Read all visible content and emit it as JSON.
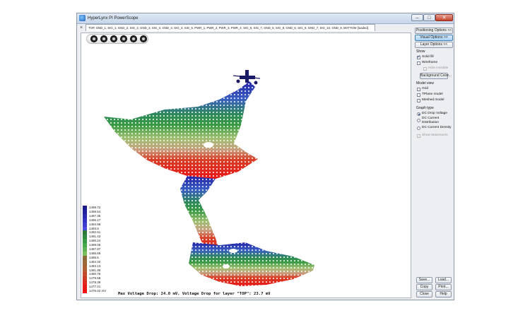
{
  "window": {
    "title": "HyperLynx PI PowerScope",
    "min_symbol": "–",
    "max_symbol": "□",
    "close_symbol": "✕"
  },
  "tab": {
    "close_symbol": "×",
    "label": "TOP, GND_1, SIG_1, GND_2, SIG_2, GND_3, SIG_3, GND_4, SIG_4, SIG_5, PWR_1, PWR_2, PWR_3, PWR_4, SIG_6, SIG_7, GND_5, SIG_8, GND_6, SIG_9, GND_7, SIG_10, GND_8, BOTTOM [loaded]"
  },
  "viewport": {
    "toolbar_icons": [
      "rotate-icon",
      "pan-icon",
      "zoom-icon",
      "zoom-fit-icon",
      "view-front-icon",
      "view-top-icon"
    ],
    "status": "Max Voltage Drop: 24.0 mV, Voltage Drop for layer \"TOP\": 23.7 mV"
  },
  "legend": {
    "entries": [
      {
        "value": "1499.72",
        "color": "#1a1a8c"
      },
      {
        "value": "1498.54",
        "color": "#22229e"
      },
      {
        "value": "1497.35",
        "color": "#2a2ab0"
      },
      {
        "value": "1496.17",
        "color": "#3232c2"
      },
      {
        "value": "1494.98",
        "color": "#3d3dd1"
      },
      {
        "value": "1493.8",
        "color": "#4a4ade"
      },
      {
        "value": "1492.61",
        "color": "#2e7a3c"
      },
      {
        "value": "1491.43",
        "color": "#2f8a3f"
      },
      {
        "value": "1490.24",
        "color": "#379a44"
      },
      {
        "value": "1489.06",
        "color": "#45a84c"
      },
      {
        "value": "1487.87",
        "color": "#5db356"
      },
      {
        "value": "1486.69",
        "color": "#7fbd5c"
      },
      {
        "value": "1485.5",
        "color": "#8a6a3a"
      },
      {
        "value": "1484.32",
        "color": "#9a6a38"
      },
      {
        "value": "1483.13",
        "color": "#a56235"
      },
      {
        "value": "1481.95",
        "color": "#b55a30"
      },
      {
        "value": "1480.76",
        "color": "#c24a2a"
      },
      {
        "value": "1479.58",
        "color": "#cf3a24"
      },
      {
        "value": "1478.39",
        "color": "#dc2a1e"
      },
      {
        "value": "1477.21",
        "color": "#e81a18"
      },
      {
        "value": "1476.02 mV",
        "color": "#f21010"
      }
    ]
  },
  "panel": {
    "positioning_options": "Positioning Options <<",
    "visual_options": "Visual Options >>",
    "layer_options": "Layer Options <<",
    "show_label": "Show",
    "solid_fill": "Solid fill",
    "wireframe": "Wireframe",
    "hide_invisible": "Hide invisible",
    "background_color": "Background Color...",
    "model_view_label": "Model view",
    "grid": "Grid",
    "tplane_model": "TPlane model",
    "meshed_model": "Meshed model",
    "graph_type_label": "Graph type",
    "dc_drop_voltage": "DC Drop Voltage",
    "dc_current_distribution_1": "DC Current",
    "dc_current_distribution_2": "Distribution",
    "dc_current_density": "DC Current Density",
    "show_maximums": "Show Maximums",
    "save": "Save...",
    "load": "Load...",
    "copy": "Copy",
    "print": "Print...",
    "close": "Close",
    "help": "Help"
  }
}
